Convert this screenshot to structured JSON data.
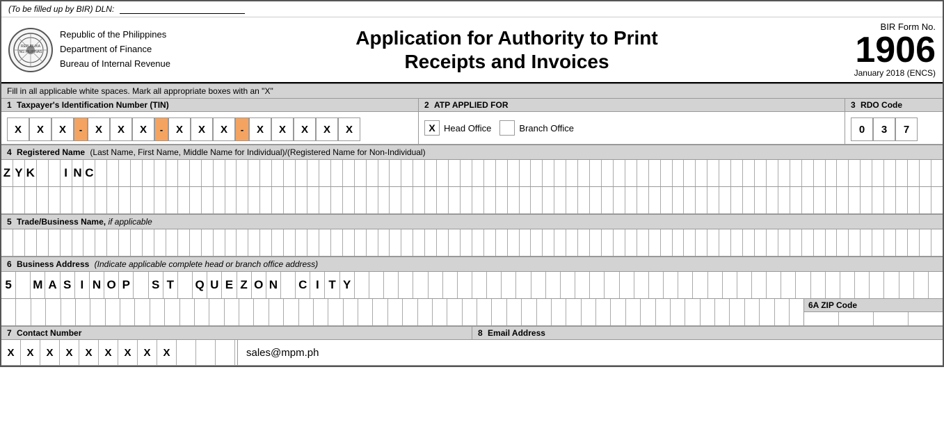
{
  "dln": {
    "label": "(To be filled up by BIR)",
    "field_label": "DLN:",
    "value": ""
  },
  "header": {
    "org_line1": "Republic of the Philippines",
    "org_line2": "Department of Finance",
    "org_line3": "Bureau of Internal Revenue",
    "title_line1": "Application for Authority to Print",
    "title_line2": "Receipts and Invoices",
    "form_no_label": "BIR Form No.",
    "form_no": "1906",
    "form_date": "January 2018 (ENCS)"
  },
  "instruction": "Fill in all applicable white spaces. Mark all appropriate boxes with an \"X\"",
  "section1": {
    "label": "1",
    "title": "Taxpayer's Identification Number (TIN)",
    "tin_digits": [
      "X",
      "X",
      "X",
      "-",
      "X",
      "X",
      "X",
      "-",
      "X",
      "X",
      "X",
      "-",
      "X",
      "X",
      "X",
      "X",
      "X"
    ]
  },
  "section2": {
    "label": "2",
    "title": "ATP APPLIED FOR",
    "head_office": {
      "checked": true,
      "label": "Head Office"
    },
    "branch_office": {
      "checked": false,
      "label": "Branch Office"
    }
  },
  "section3": {
    "label": "3",
    "title": "RDO Code",
    "digits": [
      "0",
      "3",
      "7"
    ]
  },
  "section4": {
    "label": "4",
    "title": "Registered Name",
    "subtitle": "(Last Name, First Name, Middle Name for Individual)/(Registered Name for Non-Individual)",
    "row1": [
      "Z",
      "Y",
      "K",
      " ",
      " ",
      "I",
      "N",
      "C",
      " ",
      " ",
      " ",
      " ",
      " ",
      " ",
      " ",
      " ",
      " ",
      " ",
      " ",
      " ",
      " ",
      " ",
      " ",
      " ",
      " ",
      " ",
      " ",
      " ",
      " ",
      " ",
      " ",
      " ",
      " ",
      " ",
      " ",
      " ",
      " ",
      " ",
      " ",
      " ",
      " ",
      " ",
      " ",
      " ",
      " ",
      " ",
      " ",
      " ",
      " ",
      " ",
      " ",
      " ",
      " ",
      " ",
      " ",
      " ",
      " ",
      " ",
      " ",
      " ",
      " ",
      " ",
      " ",
      " ",
      " ",
      " ",
      " ",
      " ",
      " ",
      " ",
      " ",
      " ",
      " ",
      " ",
      " ",
      " ",
      " ",
      " ",
      " ",
      " "
    ],
    "row2": [
      " ",
      " ",
      " ",
      " ",
      " ",
      " ",
      " ",
      " ",
      " ",
      " ",
      " ",
      " ",
      " ",
      " ",
      " ",
      " ",
      " ",
      " ",
      " ",
      " ",
      " ",
      " ",
      " ",
      " ",
      " ",
      " ",
      " ",
      " ",
      " ",
      " ",
      " ",
      " ",
      " ",
      " ",
      " ",
      " ",
      " ",
      " ",
      " ",
      " ",
      " ",
      " ",
      " ",
      " ",
      " ",
      " ",
      " ",
      " ",
      " ",
      " ",
      " ",
      " ",
      " ",
      " ",
      " ",
      " ",
      " ",
      " ",
      " ",
      " ",
      " ",
      " ",
      " ",
      " ",
      " ",
      " ",
      " ",
      " ",
      " ",
      " ",
      " ",
      " ",
      " ",
      " ",
      " ",
      " ",
      " ",
      " ",
      " ",
      " "
    ]
  },
  "section5": {
    "label": "5",
    "title": "Trade/Business Name,",
    "subtitle": "if applicable",
    "row1": [
      " ",
      " ",
      " ",
      " ",
      " ",
      " ",
      " ",
      " ",
      " ",
      " ",
      " ",
      " ",
      " ",
      " ",
      " ",
      " ",
      " ",
      " ",
      " ",
      " ",
      " ",
      " ",
      " ",
      " ",
      " ",
      " ",
      " ",
      " ",
      " ",
      " ",
      " ",
      " ",
      " ",
      " ",
      " ",
      " ",
      " ",
      " ",
      " ",
      " ",
      " ",
      " ",
      " ",
      " ",
      " ",
      " ",
      " ",
      " ",
      " ",
      " ",
      " ",
      " ",
      " ",
      " ",
      " ",
      " ",
      " ",
      " ",
      " ",
      " ",
      " ",
      " ",
      " ",
      " ",
      " ",
      " ",
      " ",
      " ",
      " ",
      " ",
      " ",
      " ",
      " ",
      " ",
      " ",
      " ",
      " ",
      " ",
      " ",
      " "
    ]
  },
  "section6": {
    "label": "6",
    "title": "Business Address",
    "subtitle": "(Indicate applicable complete head or branch office address)",
    "row1": [
      "5",
      " ",
      "M",
      "A",
      "S",
      "I",
      "N",
      "O",
      "P",
      " ",
      "S",
      "T",
      " ",
      "Q",
      "U",
      "E",
      "Z",
      "O",
      "N",
      " ",
      "C",
      "I",
      "T",
      "Y",
      " ",
      " ",
      " ",
      " ",
      " ",
      " ",
      " ",
      " ",
      " ",
      " ",
      " ",
      " ",
      " ",
      " ",
      " ",
      " ",
      " ",
      " ",
      " ",
      " ",
      " ",
      " ",
      " ",
      " ",
      " ",
      " ",
      " ",
      " ",
      " ",
      " ",
      " ",
      " ",
      " ",
      " ",
      " ",
      " ",
      " ",
      " ",
      " ",
      " "
    ],
    "row2": [
      " ",
      " ",
      " ",
      " ",
      " ",
      " ",
      " ",
      " ",
      " ",
      " ",
      " ",
      " ",
      " ",
      " ",
      " ",
      " ",
      " ",
      " ",
      " ",
      " ",
      " ",
      " ",
      " ",
      " ",
      " ",
      " ",
      " ",
      " ",
      " ",
      " ",
      " ",
      " ",
      " ",
      " ",
      " ",
      " ",
      " ",
      " ",
      " ",
      " ",
      " ",
      " ",
      " ",
      " ",
      " ",
      " ",
      " ",
      " ",
      " ",
      " ",
      " ",
      " ",
      " ",
      " "
    ],
    "zip_label": "6A ZIP Code",
    "zip_digits": [
      " ",
      " ",
      " ",
      " "
    ]
  },
  "section7": {
    "label": "7",
    "title": "Contact Number",
    "digits": [
      "X",
      "X",
      "X",
      "X",
      "X",
      "X",
      "X",
      "X",
      "X",
      " ",
      " ",
      " "
    ]
  },
  "section8": {
    "label": "8",
    "title": "Email Address",
    "value": "sales@mpm.ph"
  }
}
